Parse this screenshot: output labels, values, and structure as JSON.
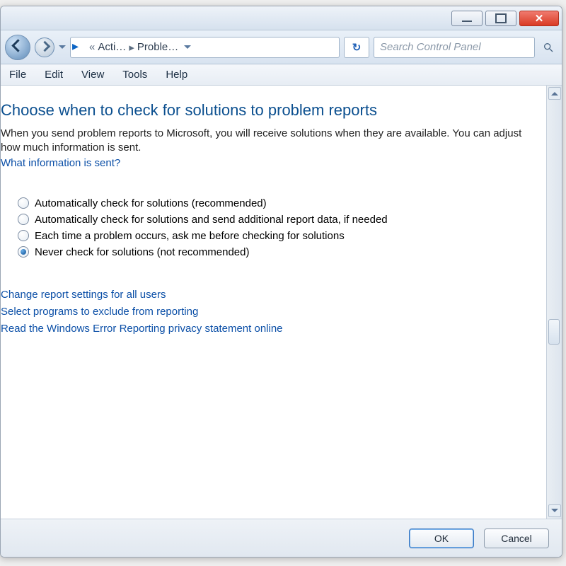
{
  "titlebar": {},
  "breadcrumb": {
    "level1": "Acti…",
    "level2": "Proble…"
  },
  "search": {
    "placeholder": "Search Control Panel"
  },
  "menu": {
    "file": "File",
    "edit": "Edit",
    "view": "View",
    "tools": "Tools",
    "help": "Help"
  },
  "page": {
    "heading": "Choose when to check for solutions to problem reports",
    "body": "When you send problem reports to Microsoft, you will receive solutions when they are available. You can adjust how much information is sent.",
    "info_link": "What information is sent?"
  },
  "options": {
    "o1": "Automatically check for solutions (recommended)",
    "o2": "Automatically check for solutions and send additional report data, if needed",
    "o3": "Each time a problem occurs, ask me before checking for solutions",
    "o4": "Never check for solutions (not recommended)"
  },
  "links": {
    "l1": "Change report settings for all users",
    "l2": "Select programs to exclude from reporting",
    "l3": "Read the Windows Error Reporting privacy statement online"
  },
  "buttons": {
    "ok": "OK",
    "cancel": "Cancel"
  }
}
